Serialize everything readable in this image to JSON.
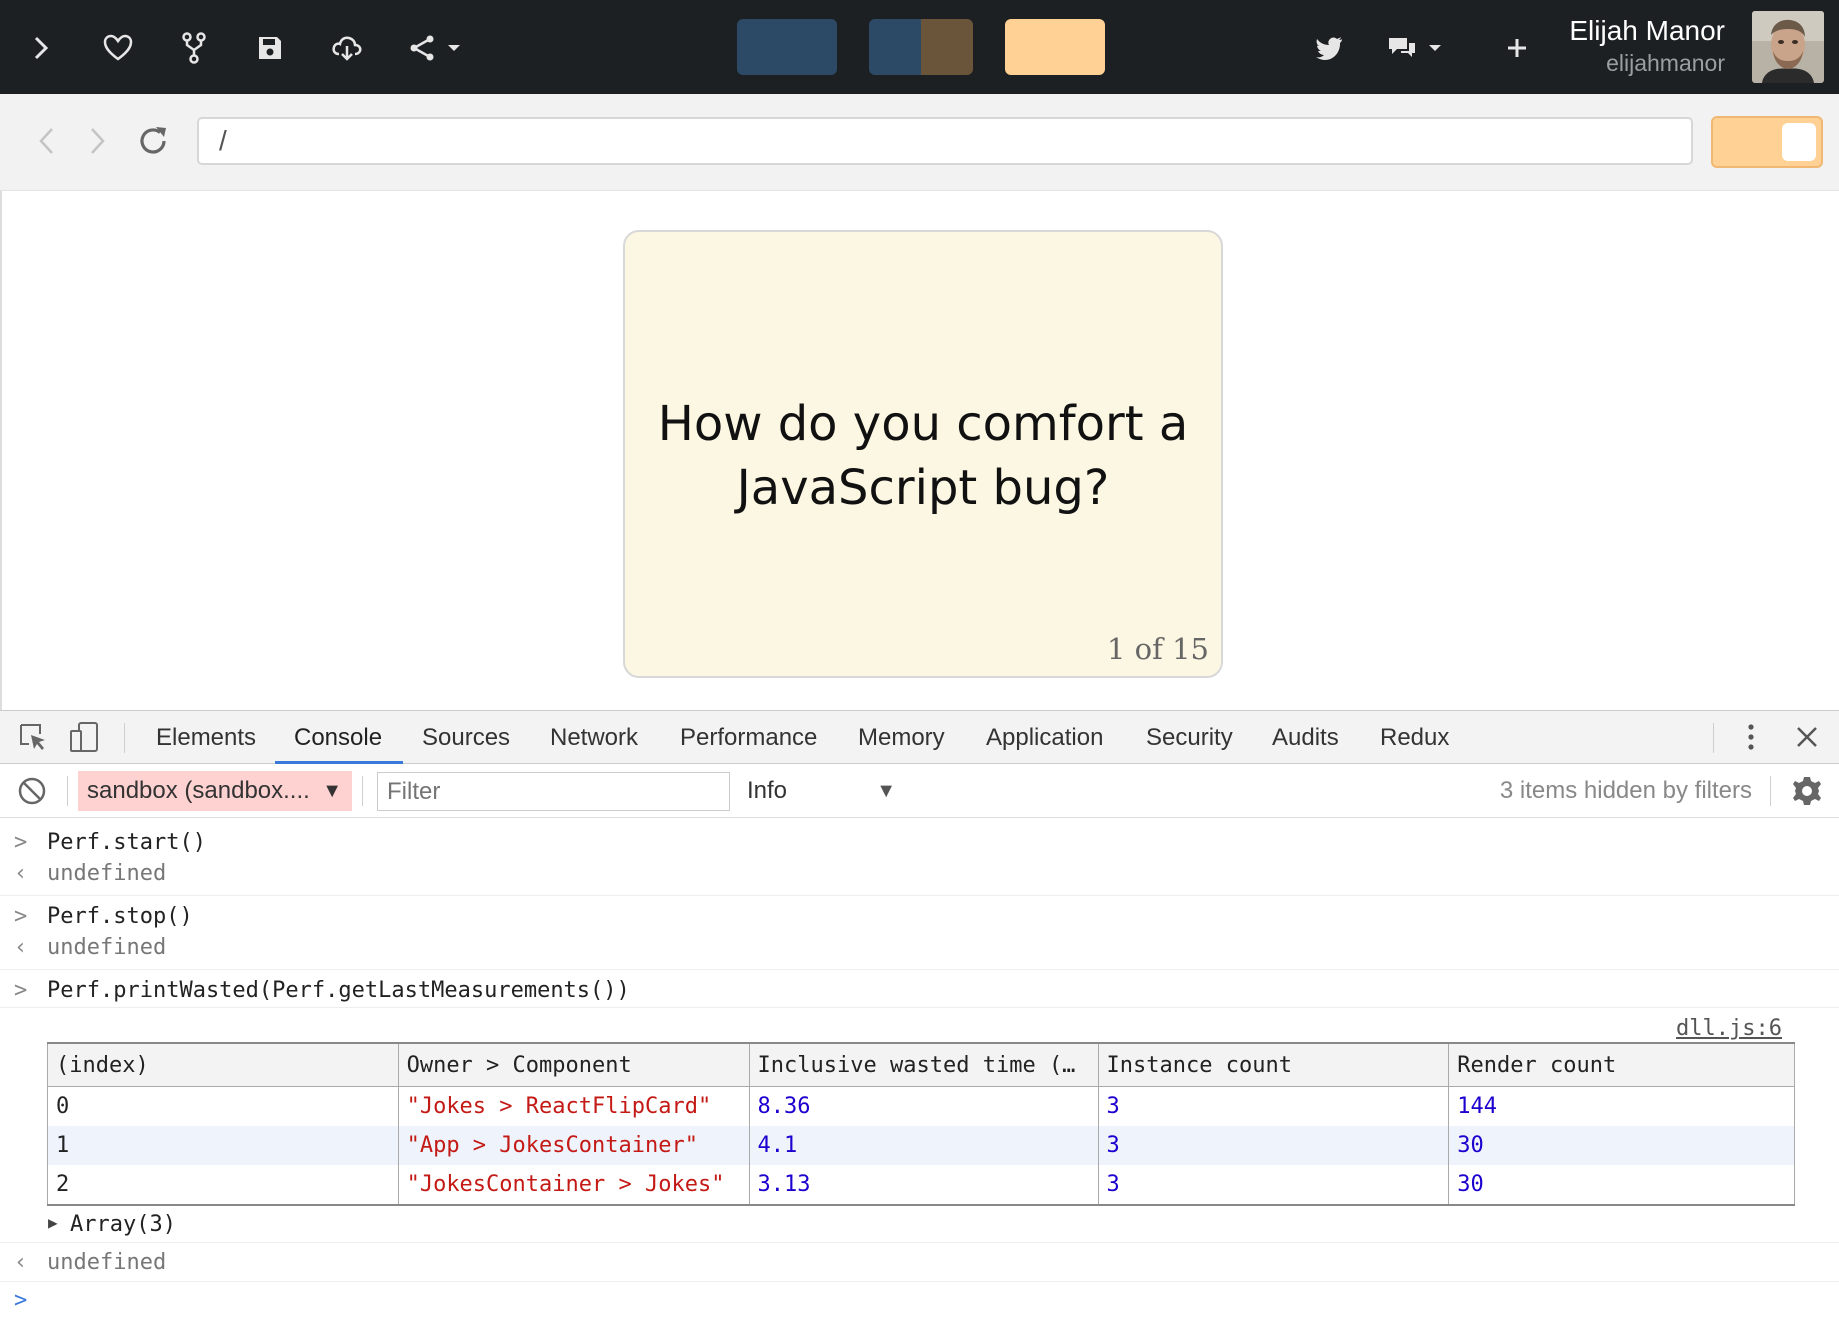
{
  "topbar": {
    "colors": {
      "swatch1": "#2c4a66",
      "swatch2_left": "#2c4a66",
      "swatch2_right": "#6b553a",
      "swatch3": "#ffd195"
    },
    "user": {
      "name": "Elijah Manor",
      "handle": "elijahmanor"
    }
  },
  "browser": {
    "url": "/"
  },
  "card": {
    "question": "How do you comfort a JavaScript bug?",
    "counter": "1 of 15"
  },
  "devtools": {
    "tabs": [
      "Elements",
      "Console",
      "Sources",
      "Network",
      "Performance",
      "Memory",
      "Application",
      "Security",
      "Audits",
      "Redux"
    ],
    "active_tab": "Console",
    "context": "sandbox (sandbox....",
    "filter_placeholder": "Filter",
    "level": "Info",
    "hidden_count": "3 items hidden by filters"
  },
  "console": {
    "lines": [
      {
        "type": "input",
        "text": "Perf.start()"
      },
      {
        "type": "result",
        "text": "undefined"
      },
      {
        "type": "input",
        "text": "Perf.stop()"
      },
      {
        "type": "result",
        "text": "undefined"
      },
      {
        "type": "input",
        "text": "Perf.printWasted(Perf.getLastMeasurements())"
      }
    ],
    "source_link": "dll.js:6",
    "table": {
      "headers": [
        "(index)",
        "Owner > Component",
        "Inclusive wasted time (…",
        "Instance count",
        "Render count"
      ],
      "rows": [
        [
          "0",
          "\"Jokes > ReactFlipCard\"",
          "8.36",
          "3",
          "144"
        ],
        [
          "1",
          "\"App > JokesContainer\"",
          "4.1",
          "3",
          "30"
        ],
        [
          "2",
          "\"JokesContainer > Jokes\"",
          "3.13",
          "3",
          "30"
        ]
      ]
    },
    "array_summary": "Array(3)",
    "final_result": "undefined"
  }
}
